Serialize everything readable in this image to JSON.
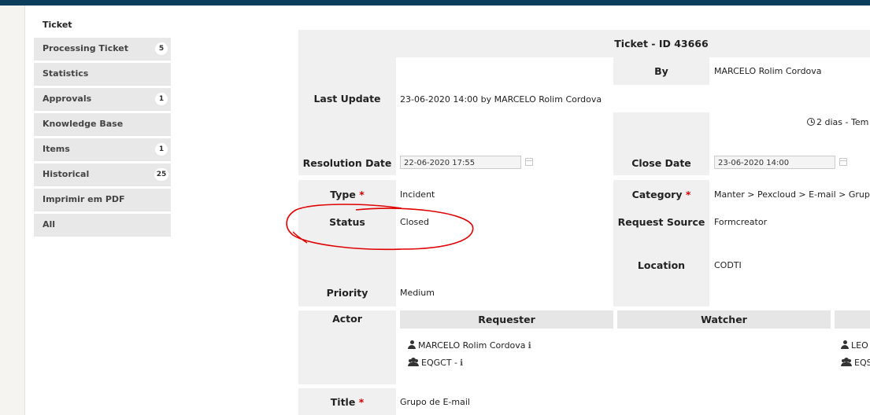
{
  "tabs": {
    "active": "Ticket",
    "items": [
      {
        "label": "Processing Ticket",
        "badge": "5"
      },
      {
        "label": "Statistics",
        "badge": ""
      },
      {
        "label": "Approvals",
        "badge": "1"
      },
      {
        "label": "Knowledge Base",
        "badge": ""
      },
      {
        "label": "Items",
        "badge": "1"
      },
      {
        "label": "Historical",
        "badge": "25"
      },
      {
        "label": "Imprimir em PDF",
        "badge": ""
      },
      {
        "label": "All",
        "badge": ""
      }
    ]
  },
  "ticket": {
    "title": "Ticket - ID 43666",
    "by_label": "By",
    "by_value": "MARCELO Rolim Cordova",
    "last_update_label": "Last Update",
    "last_update_value": "23-06-2020 14:00 by MARCELO Rolim Cordova",
    "time_value": "2 dias - Tem",
    "resolution_label": "Resolution Date",
    "resolution_value": "22-06-2020 17:55",
    "close_label": "Close Date",
    "close_value": "23-06-2020 14:00",
    "type_label": "Type",
    "type_value": "Incident",
    "category_label": "Category",
    "category_value": "Manter > Pexcloud > E-mail > Grup",
    "status_label": "Status",
    "status_value": "Closed",
    "source_label": "Request Source",
    "source_value": "Formcreator",
    "location_label": "Location",
    "location_value": "CODTI",
    "priority_label": "Priority",
    "priority_value": "Medium",
    "actor_label": "Actor",
    "requester_label": "Requester",
    "watcher_label": "Watcher",
    "requester_user": "MARCELO Rolim Cordova",
    "requester_group": "EQGCT -",
    "assigned_user": "LEO",
    "assigned_group": "EQS",
    "title_label": "Title",
    "title_value": "Grupo de E-mail",
    "required_mark": "*",
    "info_mark": "ℹ"
  },
  "colors": {
    "topbar": "#0d3d5c",
    "annotation": "#e00000",
    "required": "#d20000"
  }
}
